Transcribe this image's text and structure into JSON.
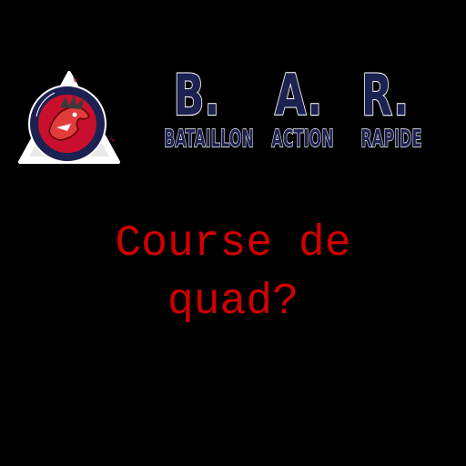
{
  "colors": {
    "background": "#000000",
    "question_red": "#d10000",
    "brand_navy": "#1b2150",
    "brand_outline": "#ffffff",
    "emblem_red": "#c8102e"
  },
  "logo": {
    "icon": "bar-emblem-icon",
    "ring_text": "BATAILLON ACTION RAPIDE"
  },
  "brand": {
    "letters": [
      "B.",
      "A.",
      "R."
    ],
    "words": [
      "BATAILLON",
      "ACTION",
      "RAPIDE"
    ]
  },
  "question": {
    "line1": "Course de",
    "line2": "quad?"
  }
}
